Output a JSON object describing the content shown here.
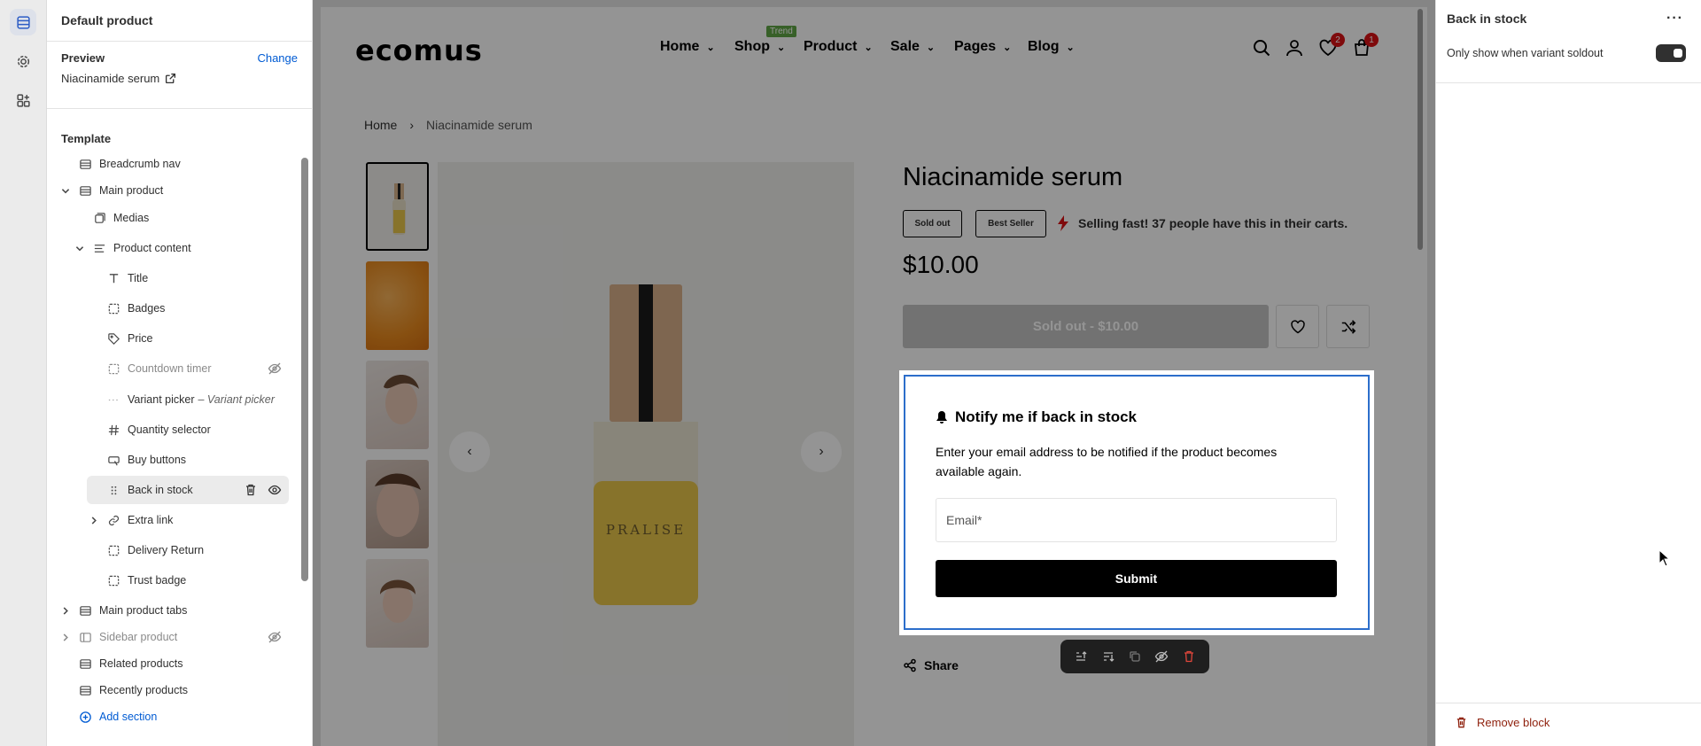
{
  "sidebar": {
    "title": "Default product",
    "preview_label": "Preview",
    "change_label": "Change",
    "preview_value": "Niacinamide serum",
    "template_label": "Template",
    "items": [
      {
        "label": "Breadcrumb nav"
      },
      {
        "label": "Main product"
      },
      {
        "label": "Medias"
      },
      {
        "label": "Product content"
      },
      {
        "label": "Title"
      },
      {
        "label": "Badges"
      },
      {
        "label": "Price"
      },
      {
        "label": "Countdown timer"
      },
      {
        "label": "Variant picker",
        "sub": "– Variant picker"
      },
      {
        "label": "Quantity selector"
      },
      {
        "label": "Buy buttons"
      },
      {
        "label": "Back in stock"
      },
      {
        "label": "Extra link"
      },
      {
        "label": "Delivery Return"
      },
      {
        "label": "Trust badge"
      },
      {
        "label": "Main product tabs"
      },
      {
        "label": "Sidebar product"
      },
      {
        "label": "Related products"
      },
      {
        "label": "Recently products"
      },
      {
        "label": "Add section"
      }
    ]
  },
  "store": {
    "logo": "ecomus",
    "nav": [
      "Home",
      "Shop",
      "Product",
      "Sale",
      "Pages",
      "Blog"
    ],
    "trend_badge": "Trend",
    "wishlist_count": "2",
    "cart_count": "1",
    "breadcrumb": {
      "home": "Home",
      "current": "Niacinamide serum"
    },
    "product": {
      "title": "Niacinamide serum",
      "badge_sold_out": "Sold out",
      "badge_best_seller": "Best Seller",
      "selling_fast": "Selling fast! 37 people have this in their carts.",
      "price": "$10.00",
      "sold_out_button": "Sold out - $10.00",
      "bottle_brand": "PRALISE"
    },
    "notify": {
      "title": "Notify me if back in stock",
      "description": "Enter your email address to be notified if the product becomes available again.",
      "email_placeholder": "Email*",
      "submit_label": "Submit"
    },
    "share_label": "Share"
  },
  "right_panel": {
    "title": "Back in stock",
    "toggle_label": "Only show when variant soldout",
    "toggle_on": true,
    "remove_label": "Remove block"
  },
  "colors": {
    "accent_blue": "#2c6ecb",
    "link_blue": "#005bd3",
    "badge_red": "#db1215",
    "trend_green": "#5fa545",
    "remove_red": "#8e1f0b"
  }
}
